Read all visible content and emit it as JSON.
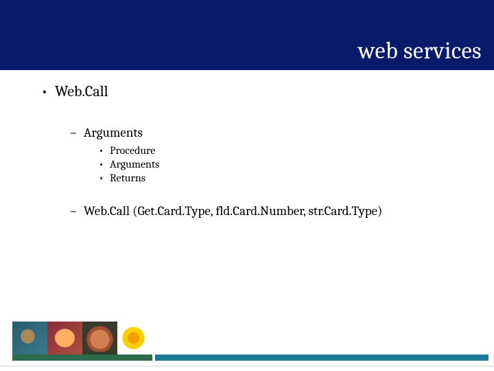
{
  "title": "web services",
  "bullets": {
    "webcall_label": "Web.Call",
    "arguments_label": "Arguments",
    "arg_items": {
      "procedure": "Procedure",
      "arguments": "Arguments",
      "returns": "Returns"
    },
    "example_call": "Web.Call (Get.Card.Type, fld.Card.Number, str.Card.Type)"
  }
}
